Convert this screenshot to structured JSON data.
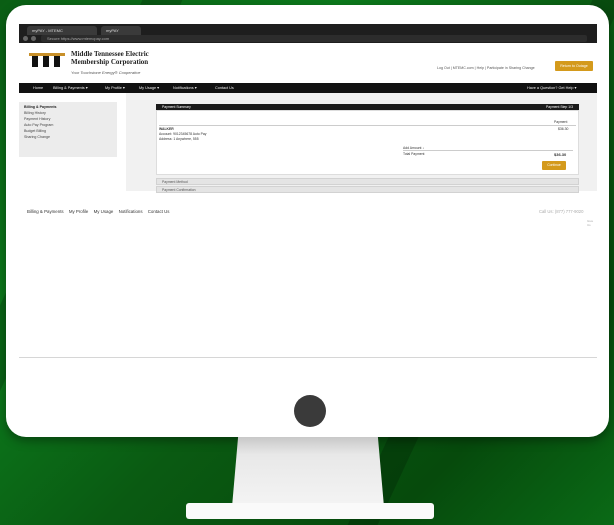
{
  "browser": {
    "tabs": [
      "myPAY - MTEMC",
      "myPAY"
    ],
    "url": "Secure  https://www.mtemcpay.com"
  },
  "header": {
    "org_name_line1": "Middle Tennessee Electric",
    "org_name_line2": "Membership Corporation",
    "tagline": "Your Touchstone Energy® Cooperative",
    "util_links": "Log Out  |  MTEMC.com  |  Help  |  Participate in Sharing Change",
    "pay_button": "Return to Outage"
  },
  "nav": {
    "items": [
      "Home",
      "Billing & Payments ▾",
      "My Profile ▾",
      "My Usage ▾",
      "Notifications ▾",
      "Contact Us"
    ],
    "right": "Have a Question? Get Help ▾"
  },
  "sidebar": {
    "heading": "Billing & Payments",
    "items": [
      "Billing History",
      "Payment History",
      "Auto Pay Program",
      "Budget Billing",
      "Sharing Change"
    ]
  },
  "summary": {
    "title": "Payment Summary",
    "step": "Payment Step 1/3",
    "col_header": "Payment",
    "account_name": "WALKER",
    "account_line1": "Account: 9012345678  Auto Pay",
    "account_line2": "Address: 1 Anywhere, 555",
    "amount_right": "$36.30",
    "add_amount_label": "Add Amount ↓",
    "total_label": "Total Payment",
    "total_value": "$36.30",
    "continue_button": "Continue"
  },
  "sections": [
    "Payment Method",
    "Payment Confirmation"
  ],
  "footer": {
    "links": [
      "Billing & Payments",
      "My Profile",
      "My Usage",
      "Notifications",
      "Contact Us"
    ],
    "phone": "Call Us: (877) 777-9020",
    "sub": "Give Us"
  }
}
